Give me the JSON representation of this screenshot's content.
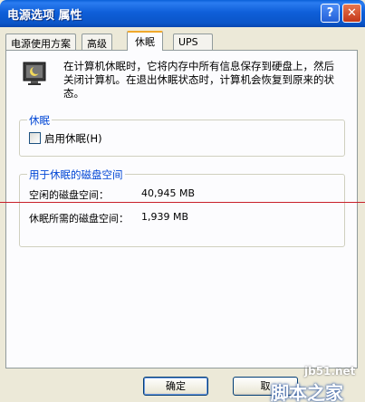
{
  "window": {
    "title": "电源选项 属性",
    "help_label": "?",
    "close_label": "✕"
  },
  "tabs": [
    {
      "label": "电源使用方案"
    },
    {
      "label": "高级"
    },
    {
      "label": "休眠"
    },
    {
      "label": "UPS"
    }
  ],
  "active_tab": "休眠",
  "intro": "在计算机休眠时，它将内存中所有信息保存到硬盘上，然后关闭计算机。在退出休眠状态时，计算机会恢复到原来的状态。",
  "hibernate_group": {
    "legend": "休眠",
    "checkbox_label": "启用休眠(H)",
    "checked": false
  },
  "disk_group": {
    "legend": "用于休眠的磁盘空间",
    "free_label": "空闲的磁盘空间：",
    "free_value": "40,945 MB",
    "required_label": "休眠所需的磁盘空间：",
    "required_value": "1,939 MB"
  },
  "buttons": {
    "ok": "确定",
    "cancel": "取"
  },
  "watermark": {
    "url": "jb51.net",
    "text": "脚本之家"
  },
  "colors": {
    "titlebar": "#0a5fd8",
    "legend": "#0046d5",
    "red_line": "#c8202a"
  },
  "icons": {
    "hibernate": "hibernate-monitor-icon"
  }
}
